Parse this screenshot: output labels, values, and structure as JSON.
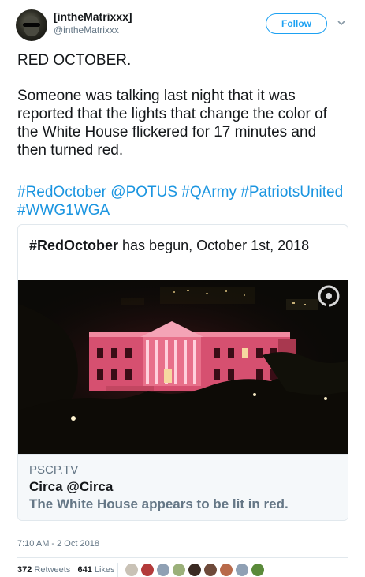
{
  "author": {
    "display_name": "[intheMatrixxx]",
    "handle": "@intheMatrixxx",
    "avatar_icon": "avatar-photo"
  },
  "follow_label": "Follow",
  "tweet": {
    "line1": "RED OCTOBER.",
    "line2": "Someone was talking last night that it was reported that the lights that change the color of the White House flickered for 17 minutes and then turned red.",
    "hashtags": "#RedOctober @POTUS #QArmy #PatriotsUnited #WWG1WGA"
  },
  "card": {
    "quote_bold": "#RedOctober",
    "quote_rest": " has begun, October 1st, 2018",
    "image_subject": "White House lit in red at night",
    "domain": "PSCP.TV",
    "title": "Circa @Circa",
    "description": "The White House appears to be lit in red."
  },
  "timestamp": "7:10 AM - 2 Oct 2018",
  "stats": {
    "retweets_count": "372",
    "retweets_label": "Retweets",
    "likes_count": "641",
    "likes_label": "Likes"
  },
  "colors": {
    "link": "#1b95e0",
    "follow": "#1da1f2",
    "secondary": "#657786"
  },
  "likers": [
    {
      "icon": "liker-avatar-1",
      "color": "#c9c2b6"
    },
    {
      "icon": "liker-avatar-2",
      "color": "#b33a3a"
    },
    {
      "icon": "liker-avatar-3",
      "color": "#8fa0b4"
    },
    {
      "icon": "liker-avatar-4",
      "color": "#9bb07a"
    },
    {
      "icon": "liker-avatar-5",
      "color": "#3a2a22"
    },
    {
      "icon": "liker-avatar-6",
      "color": "#6e4a3a"
    },
    {
      "icon": "liker-avatar-7",
      "color": "#b86a4a"
    },
    {
      "icon": "liker-avatar-8",
      "color": "#8fa0b4"
    },
    {
      "icon": "liker-avatar-9",
      "color": "#5a8a3a"
    }
  ]
}
